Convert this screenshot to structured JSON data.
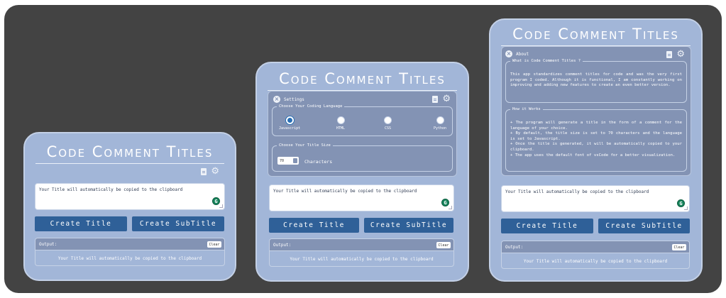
{
  "app_title": "Code Comment Titles",
  "textarea_text": "Your Title will automatically be copied to the clipboard",
  "badge_letter": "G",
  "buttons": {
    "create_title": "Create Title",
    "create_subtitle": "Create SubTitle"
  },
  "output": {
    "label": "Output:",
    "clear": "Clear",
    "text": "Your Title will automatically be copied to the clipboard"
  },
  "settings": {
    "header": "Settings",
    "language_legend": "Choose Your Coding Language",
    "languages": [
      {
        "label": "Javascript",
        "selected": true
      },
      {
        "label": "HTML",
        "selected": false
      },
      {
        "label": "CSS",
        "selected": false
      },
      {
        "label": "Python",
        "selected": false
      }
    ],
    "size_legend": "Choose Your Title Size",
    "size_value": "70",
    "size_unit": "Characters"
  },
  "about": {
    "header": "About",
    "what_legend": "What is Code Comment Titles ?",
    "what_text": "This app standardizes comment titles for code and was the very first program I coded. Although it is functional, I am constantly working on improving and adding new features to create an even better version.",
    "how_legend": "How it Works",
    "how_lines": [
      "+ The program will generate a title in the form of a comment for the language of your choice.",
      "+ By default, the title size is set to 70 characters and the language is set to Javascript.",
      "+ Once the title is generated, it will be automatically copied to your clipboard.",
      "+ The app uses the default font of vsCode for a better visualization."
    ]
  },
  "colors": {
    "frame": "#434343",
    "card": "#a2b6d8",
    "panel": "#8393b4",
    "button": "#2f6098",
    "badge": "#17845c"
  }
}
